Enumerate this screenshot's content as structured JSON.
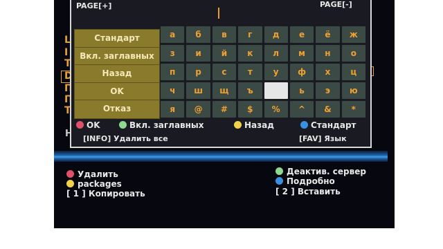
{
  "dialog": {
    "page_prev": "PAGE[+]",
    "page_next": "PAGE[-]",
    "function_keys": [
      "Стандарт",
      "Вкл. заглавных",
      "Назад",
      "OK",
      "Отказ"
    ],
    "characters": [
      [
        "а",
        "б",
        "в",
        "г",
        "д",
        "е",
        "ё",
        "ж"
      ],
      [
        "з",
        "и",
        "й",
        "к",
        "л",
        "м",
        "н",
        "о"
      ],
      [
        "п",
        "р",
        "с",
        "т",
        "у",
        "ф",
        "х",
        "ц"
      ],
      [
        "ч",
        "ш",
        "щ",
        "ъ",
        "",
        "ь",
        "э",
        "ю"
      ],
      [
        "я",
        "@",
        "#",
        "$",
        "%",
        "^",
        "&",
        "*"
      ]
    ],
    "selected": {
      "row": 3,
      "col": 4
    },
    "legend": {
      "red": "OK",
      "green": "Вкл. заглавных",
      "yellow": "Назад",
      "blue": "Стандарт"
    },
    "info_hint": "[INFO] Удалить все",
    "fav_hint": "[FAV] Язык"
  },
  "background_menu": {
    "side_letters": [
      "L",
      "I",
      "T",
      "D",
      "П",
      "П",
      "Т"
    ],
    "partial_h": "H"
  },
  "bottom_bar": {
    "red_label": "Удалить",
    "yellow_label": "packages",
    "copy_hint": "[ 1 ] Копировать",
    "green_label": "Деактив. сервер",
    "blue_label": "Подробно",
    "paste_hint": "[ 2 ] Вставить"
  },
  "colors": {
    "red": "#e0506a",
    "green": "#8fd88f",
    "yellow": "#f1d24a",
    "blue": "#3a8fe0",
    "key_bg": "#3c4a46",
    "key_text": "#f0a030",
    "fn_bg": "#8a7a2c"
  }
}
